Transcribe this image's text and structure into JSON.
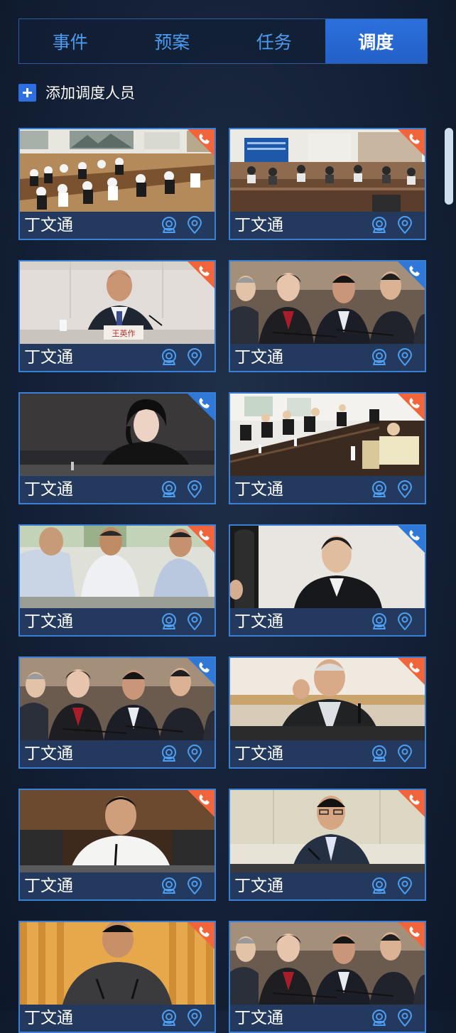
{
  "tabs": [
    {
      "label": "事件"
    },
    {
      "label": "预案"
    },
    {
      "label": "任务"
    },
    {
      "label": "调度"
    }
  ],
  "active_tab_index": 3,
  "add_action": {
    "label": "添加调度人员"
  },
  "colors": {
    "accent": "#2c6ee0",
    "tab_text": "#4b9bf0",
    "card_border": "#3a7fd6",
    "card_footer": "#233a5e",
    "badge_orange": "#f2653a",
    "badge_blue": "#2f78d8",
    "icon_blue": "#4d9ef0"
  },
  "cards": [
    {
      "name": "丁文通",
      "badge": "orange",
      "scene": "conference-room-wide"
    },
    {
      "name": "丁文通",
      "badge": "orange",
      "scene": "meeting-hall-screen"
    },
    {
      "name": "丁文通",
      "badge": "orange",
      "scene": "man-speaking-nameplate"
    },
    {
      "name": "丁文通",
      "badge": "blue",
      "scene": "officials-row"
    },
    {
      "name": "丁文通",
      "badge": "blue",
      "scene": "woman-speaking"
    },
    {
      "name": "丁文通",
      "badge": "orange",
      "scene": "meeting-table-long"
    },
    {
      "name": "丁文通",
      "badge": "orange",
      "scene": "three-men-seated"
    },
    {
      "name": "丁文通",
      "badge": "blue",
      "scene": "man-leather-chair"
    },
    {
      "name": "丁文通",
      "badge": "blue",
      "scene": "officials-row"
    },
    {
      "name": "丁文通",
      "badge": "orange",
      "scene": "man-gesturing"
    },
    {
      "name": "丁文通",
      "badge": "orange",
      "scene": "man-white-shirt-mic"
    },
    {
      "name": "丁文通",
      "badge": "orange",
      "scene": "man-glasses-mic"
    },
    {
      "name": "丁文通",
      "badge": "orange",
      "scene": "man-orange-curtain"
    },
    {
      "name": "丁文通",
      "badge": "orange",
      "scene": "officials-row"
    }
  ],
  "icons": {
    "add": "plus-icon",
    "phone": "phone-icon",
    "camera": "camera-icon",
    "location": "location-pin-icon"
  }
}
